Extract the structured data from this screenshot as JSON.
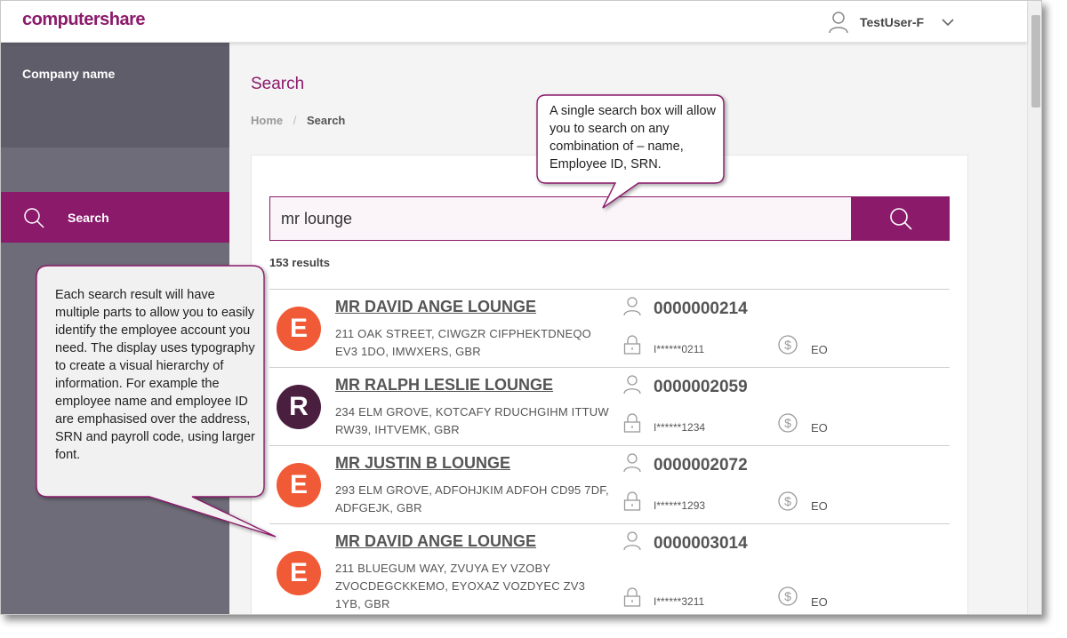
{
  "header": {
    "logo_text": "computershare",
    "user_name": "TestUser-F",
    "icons": {
      "user": "user-icon",
      "menu": "chevron-down-icon"
    }
  },
  "sidebar": {
    "company_name": "Company name",
    "items": [
      {
        "label": "Search",
        "icon": "search-icon",
        "active": true
      }
    ]
  },
  "main": {
    "page_title": "Search",
    "breadcrumb": {
      "home": "Home",
      "separator": "/",
      "current": "Search"
    },
    "search": {
      "value": "mr lounge",
      "button_icon": "search-icon"
    },
    "results_count": "153 results",
    "results": [
      {
        "initial": "E",
        "avatar_color": "#f05a36",
        "name": "MR DAVID ANGE LOUNGE",
        "address": "211 OAK STREET, CIWGZR CIFPHEKTDNEQO EV3 1DO, IMWXERS, GBR",
        "employee_id": "0000000214",
        "srn": "I******0211",
        "payroll": "EO"
      },
      {
        "initial": "R",
        "avatar_color": "#4a1e3f",
        "name": "MR RALPH LESLIE LOUNGE",
        "address": "234 ELM GROVE, KOTCAFY RDUCHGIHM ITTUW RW39, IHTVEMK, GBR",
        "employee_id": "0000002059",
        "srn": "I******1234",
        "payroll": "EO"
      },
      {
        "initial": "E",
        "avatar_color": "#f05a36",
        "name": "MR JUSTIN B LOUNGE",
        "address": "293 ELM GROVE, ADFOHJKIM ADFOH CD95 7DF, ADFGEJK, GBR",
        "employee_id": "0000002072",
        "srn": "I******1293",
        "payroll": "EO"
      },
      {
        "initial": "E",
        "avatar_color": "#f05a36",
        "name": "MR DAVID ANGE LOUNGE",
        "address": "211 BLUEGUM WAY, ZVUYA EY VZOBY ZVOCDEGCKKEMO, EYOXAZ VOZDYEC ZV3 1YB, GBR",
        "employee_id": "0000003014",
        "srn": "I******3211",
        "payroll": "EO"
      }
    ]
  },
  "callouts": {
    "search_box": "A single search box will allow you to search on any combination of – name, Employee ID, SRN.",
    "results": "Each search result will have multiple parts to allow you to easily identify the employee account you need. The display uses typography to create a visual hierarchy of information. For example the employee name and employee ID are emphasised over the address, SRN and payroll code, using larger font."
  },
  "colors": {
    "brand": "#8b1a6b",
    "sidebar": "#6e6c78",
    "sidebar_dark": "#5f5d69"
  }
}
